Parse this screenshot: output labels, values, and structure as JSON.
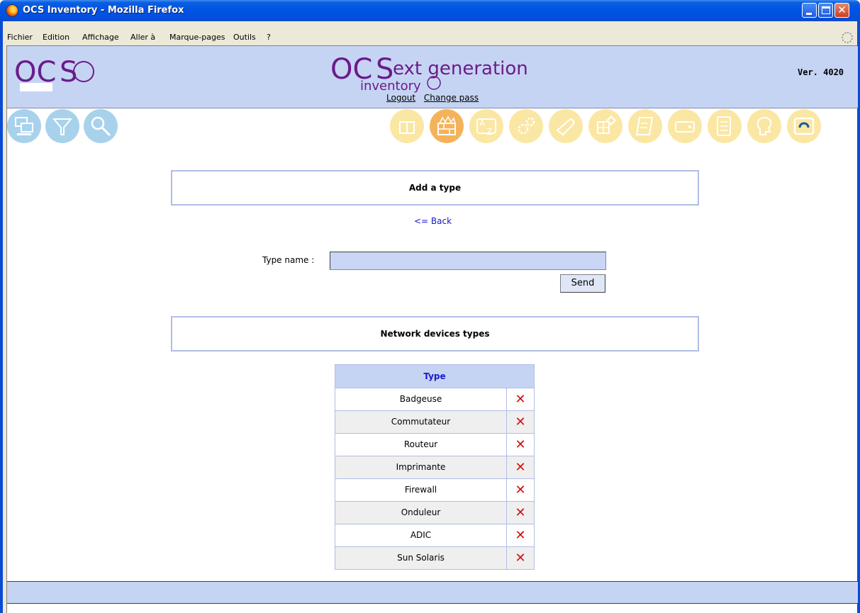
{
  "window": {
    "title": "OCS Inventory - Mozilla Firefox"
  },
  "menu": {
    "items": [
      "Fichier",
      "Edition",
      "Affichage",
      "Aller à",
      "Marque-pages",
      "Outils",
      "?"
    ]
  },
  "header": {
    "version": "Ver. 4020",
    "logout_label": "Logout",
    "change_pass_label": "Change pass"
  },
  "add_type": {
    "title": "Add a type",
    "back_label": "<= Back",
    "field_label": "Type name :",
    "field_value": "",
    "send_label": "Send"
  },
  "types": {
    "title": "Network devices types",
    "column_header": "Type",
    "rows": [
      "Badgeuse",
      "Commutateur",
      "Routeur",
      "Imprimante",
      "Firewall",
      "Onduleur",
      "ADIC",
      "Sun Solaris"
    ],
    "delete_glyph": "✕"
  },
  "colors": {
    "header_bg": "#c6d4f3",
    "link_blue": "#1515d0",
    "delete_red": "#d10f0f"
  }
}
